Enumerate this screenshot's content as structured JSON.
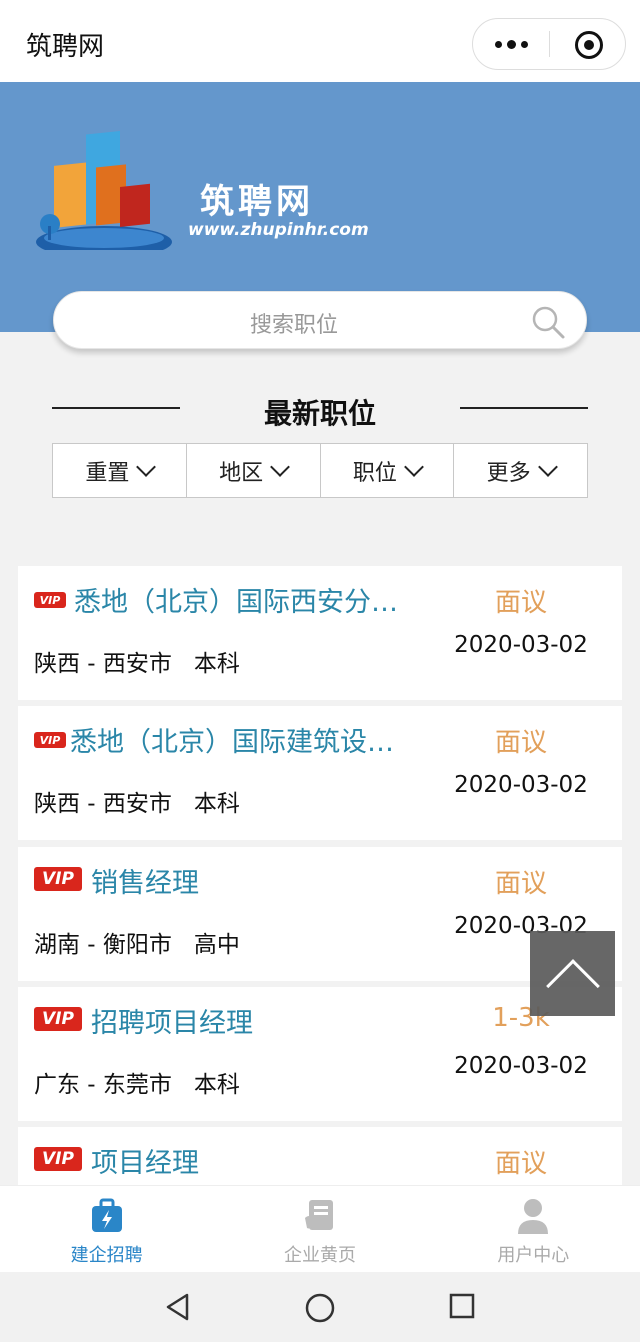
{
  "app": {
    "title": "筑聘网"
  },
  "capsule": {
    "more_icon": "more-dots-icon",
    "close_icon": "target-icon"
  },
  "banner": {
    "logo_text": "筑聘网",
    "logo_url": "www.zhupinhr.com"
  },
  "search": {
    "placeholder": "搜索职位",
    "icon": "search-icon"
  },
  "section": {
    "title": "最新职位"
  },
  "filters": [
    {
      "label": "重置"
    },
    {
      "label": "地区"
    },
    {
      "label": "职位"
    },
    {
      "label": "更多"
    }
  ],
  "jobs": [
    {
      "badge": "VIP",
      "title": "悉地（北京）国际西安分…",
      "location": "陕西 - 西安市",
      "education": "本科",
      "salary": "面议",
      "date": "2020-03-02"
    },
    {
      "badge": "VIP",
      "title": "悉地（北京）国际建筑设…",
      "location": "陕西 - 西安市",
      "education": "本科",
      "salary": "面议",
      "date": "2020-03-02"
    },
    {
      "badge": "VIP",
      "title": "销售经理",
      "location": "湖南 - 衡阳市",
      "education": "高中",
      "salary": "面议",
      "date": "2020-03-02"
    },
    {
      "badge": "VIP",
      "title": "招聘项目经理",
      "location": "广东 - 东莞市",
      "education": "本科",
      "salary": "1-3k",
      "date": "2020-03-02"
    },
    {
      "badge": "VIP",
      "title": "项目经理",
      "location": "",
      "education": "",
      "salary": "面议",
      "date": ""
    }
  ],
  "tabs": [
    {
      "label": "建企招聘",
      "icon": "briefcase-icon",
      "active": true
    },
    {
      "label": "企业黄页",
      "icon": "yellow-pages-icon",
      "active": false
    },
    {
      "label": "用户中心",
      "icon": "user-icon",
      "active": false
    }
  ],
  "colors": {
    "banner": "#6497cc",
    "job_title": "#2a86a8",
    "salary": "#e2a05b",
    "vip": "#d9261c",
    "active_tab": "#2a86c8"
  }
}
